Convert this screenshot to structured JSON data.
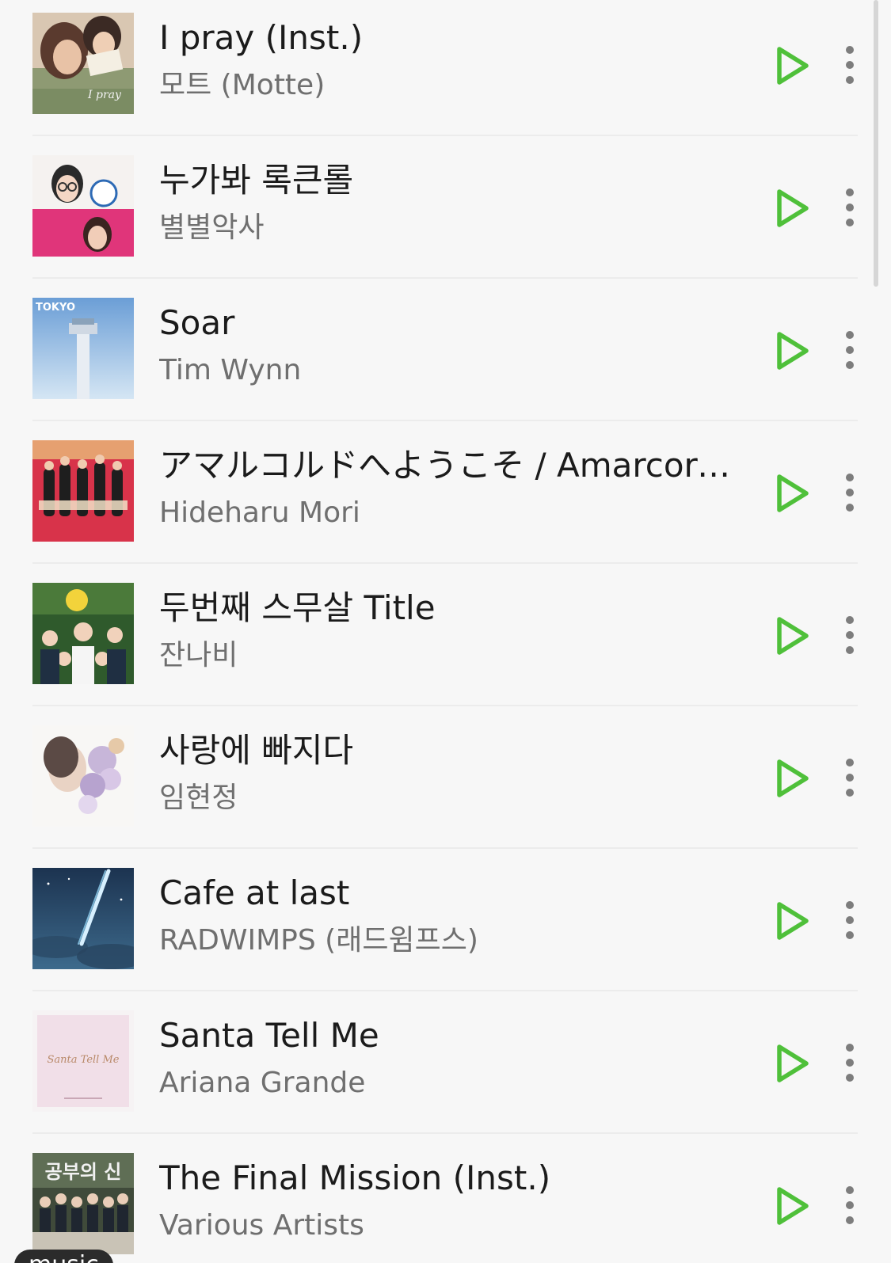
{
  "accent_color": "#4fc03a",
  "tracks": [
    {
      "title": "I pray (Inst.)",
      "artist": "모트 (Motte)",
      "cover_icon": "album-art-drama-couple"
    },
    {
      "title": "누가봐 록큰롤",
      "artist": "별별악사",
      "cover_icon": "album-art-pink-portrait"
    },
    {
      "title": "Soar",
      "artist": "Tim Wynn",
      "cover_icon": "album-art-tokyo-airport"
    },
    {
      "title": "アマルコルドへようこそ / Amarcord...",
      "artist": "Hideharu Mori",
      "cover_icon": "album-art-red-group"
    },
    {
      "title": "두번째 스무살 Title",
      "artist": "잔나비",
      "cover_icon": "album-art-green-cast"
    },
    {
      "title": "사랑에 빠지다",
      "artist": "임현정",
      "cover_icon": "album-art-floral-portrait"
    },
    {
      "title": "Cafe at last",
      "artist": "RADWIMPS (래드윔프스)",
      "cover_icon": "album-art-night-sky"
    },
    {
      "title": "Santa Tell Me",
      "artist": "Ariana Grande",
      "cover_icon": "album-art-pink-script"
    },
    {
      "title": "The Final Mission (Inst.)",
      "artist": "Various Artists",
      "cover_icon": "album-art-class-group"
    }
  ],
  "cover_texts": {
    "tokyo": "TOKYO",
    "santa": "Santa Tell Me",
    "gongbu": "공부의 신"
  },
  "bottom_pill": "music"
}
